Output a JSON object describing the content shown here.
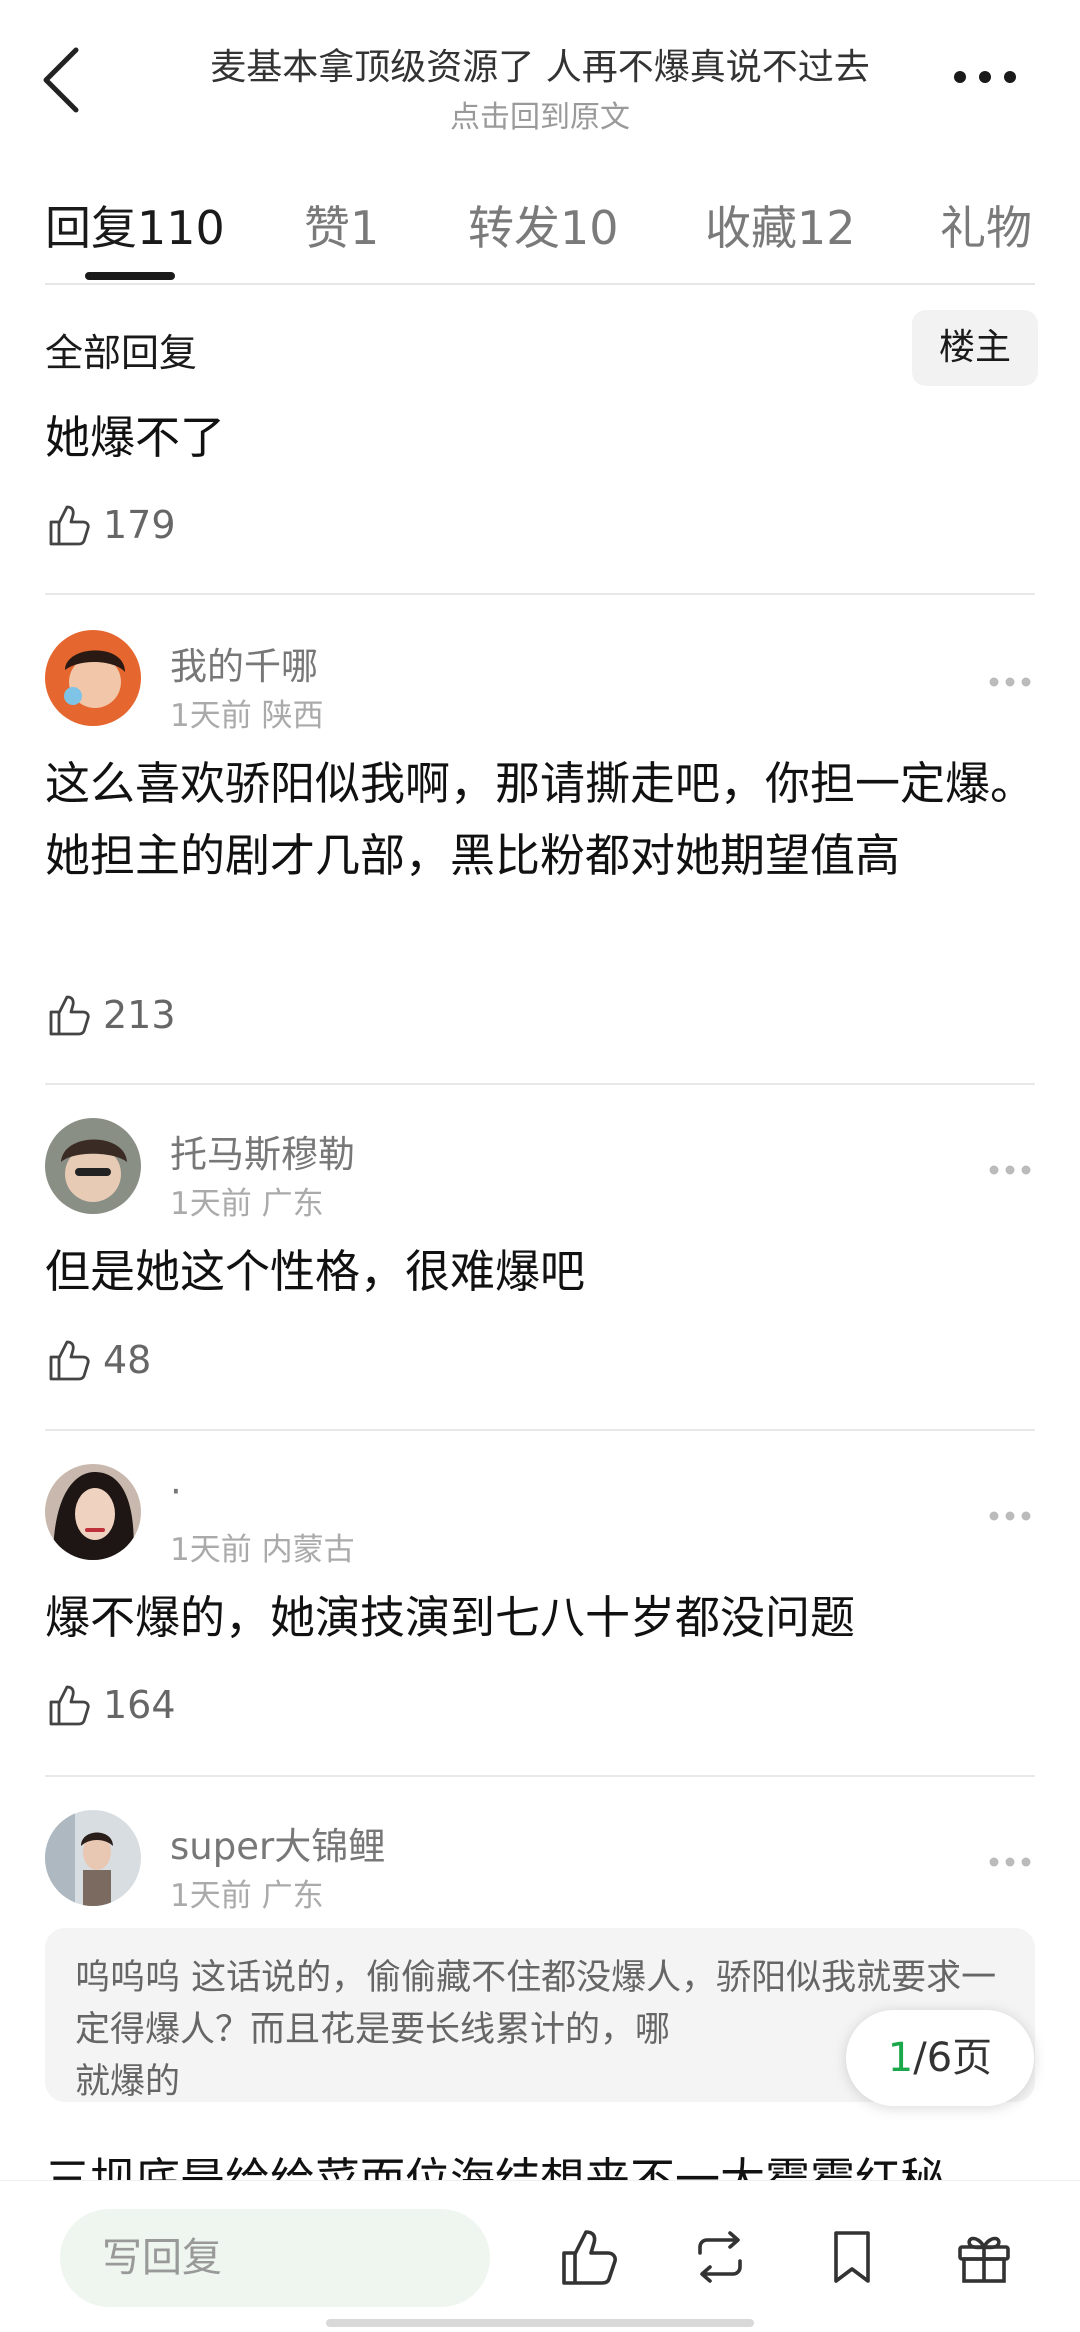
{
  "header": {
    "title": "麦基本拿顶级资源了 人再不爆真说不过去",
    "subtitle": "点击回到原文"
  },
  "tabs": [
    {
      "label": "回复",
      "count": "110"
    },
    {
      "label": "赞",
      "count": "1"
    },
    {
      "label": "转发",
      "count": "10"
    },
    {
      "label": "收藏",
      "count": "12"
    },
    {
      "label": "礼物",
      "count": ""
    }
  ],
  "section": {
    "title": "全部回复",
    "op_filter": "楼主"
  },
  "first_reply": {
    "text": "她爆不了",
    "likes": "179"
  },
  "comments": [
    {
      "user": "我的千哪",
      "time": "1天前",
      "location": "陕西",
      "text": "这么喜欢骄阳似我啊，那请撕走吧，你担一定爆。她担主的剧才几部，黑比粉都对她期望值高",
      "likes": "213"
    },
    {
      "user": "托马斯穆勒",
      "time": "1天前",
      "location": "广东",
      "text": "但是她这个性格，很难爆吧",
      "likes": "48"
    },
    {
      "user": "·",
      "time": "1天前",
      "location": "内蒙古",
      "text": "爆不爆的，她演技演到七八十岁都没问题",
      "likes": "164"
    },
    {
      "user": "super大锦鲤",
      "time": "1天前",
      "location": "广东",
      "text": "",
      "likes": ""
    }
  ],
  "quote": {
    "author": "呜呜呜",
    "text": "这话说的，偷偷藏不住都没爆人，骄阳似我就要求一定得爆人？而且花是要长线累计的，哪",
    "text_end": "就爆的"
  },
  "pagination": {
    "current": "1",
    "total": "/6页"
  },
  "peek_text": "三坝底是给给菜而位海结想来不一大霉霉红秘",
  "bottom_bar": {
    "reply_placeholder": "写回复",
    "icons": [
      "like-icon",
      "repost-icon",
      "bookmark-icon",
      "gift-icon"
    ]
  },
  "colors": {
    "accent_green": "#1aa84a",
    "reply_input_bg": "#eef6ef",
    "text_primary": "#111111",
    "text_secondary": "#777777"
  }
}
